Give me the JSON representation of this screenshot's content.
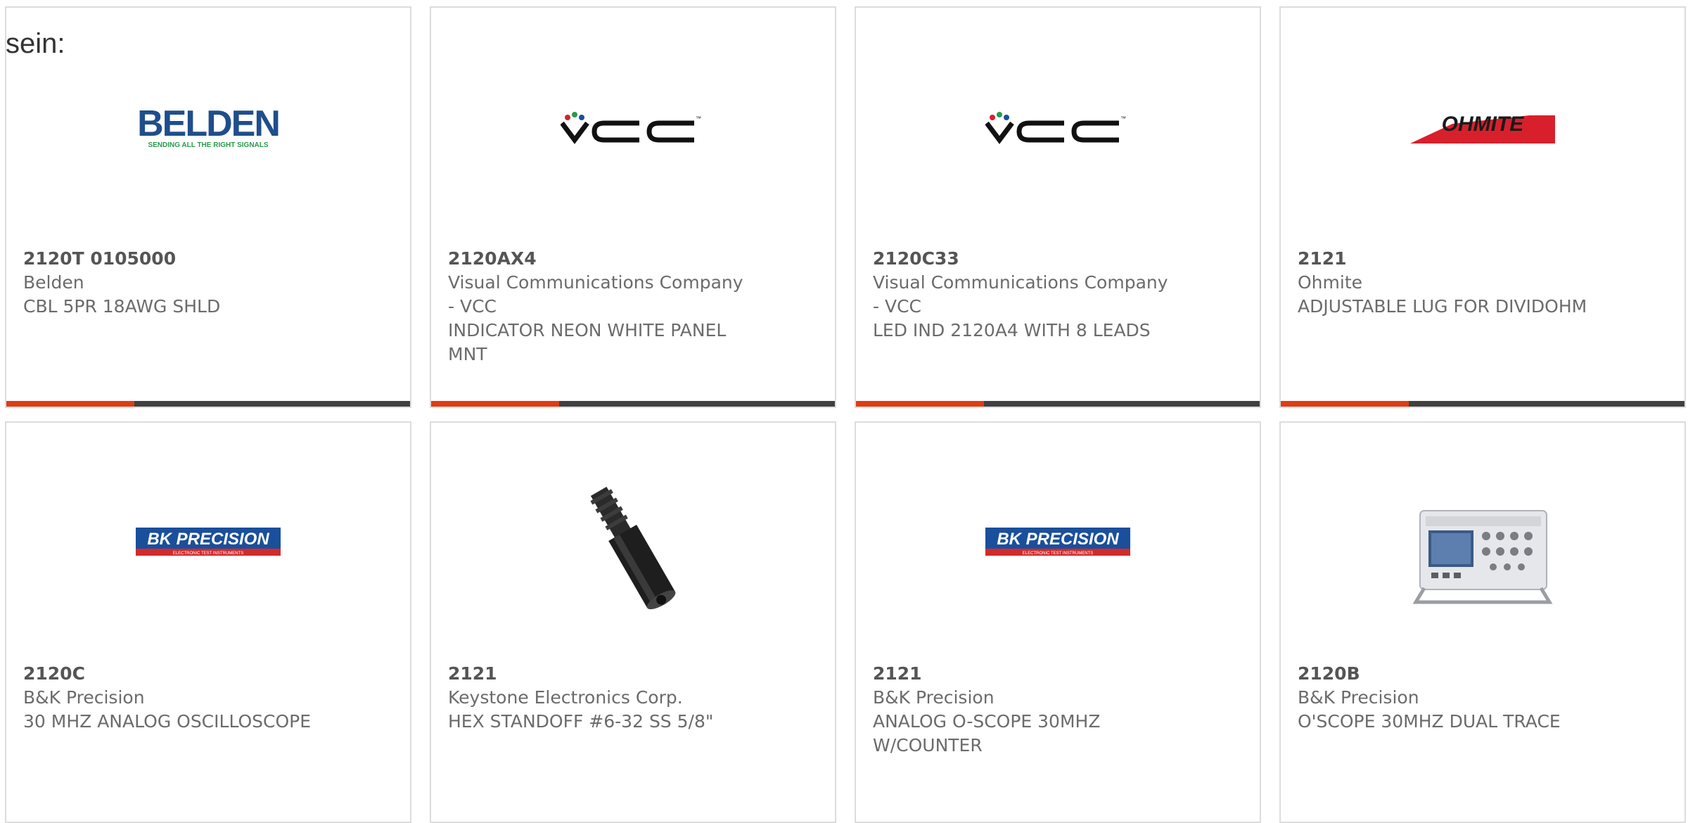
{
  "intro_text": "sein:",
  "products": [
    {
      "part": "2120T 0105000",
      "manufacturer": "Belden",
      "description": "CBL 5PR 18AWG SHLD",
      "logo": "belden-logo",
      "logo_text": "BELDEN",
      "logo_tagline": "SENDING ALL THE RIGHT SIGNALS",
      "has_bar": true
    },
    {
      "part": "2120AX4",
      "manufacturer": "Visual Communications Company - VCC",
      "description": "INDICATOR NEON WHITE PANEL MNT",
      "logo": "vcc-logo",
      "logo_text": "VCC",
      "has_bar": true
    },
    {
      "part": "2120C33",
      "manufacturer": "Visual Communications Company - VCC",
      "description": "LED IND 2120A4 WITH 8 LEADS",
      "logo": "vcc-logo",
      "logo_text": "VCC",
      "has_bar": true
    },
    {
      "part": "2121",
      "manufacturer": "Ohmite",
      "description": "ADJUSTABLE LUG FOR DIVIDOHM",
      "logo": "ohmite-logo",
      "logo_text": "OHMITE",
      "has_bar": true
    },
    {
      "part": "2120C",
      "manufacturer": "B&K Precision",
      "description": "30 MHZ ANALOG OSCILLOSCOPE",
      "logo": "bk-precision-logo",
      "logo_text": "BK PRECISION",
      "logo_tagline": "ELECTRONIC TEST INSTRUMENTS",
      "has_bar": false
    },
    {
      "part": "2121",
      "manufacturer": "Keystone Electronics Corp.",
      "description": "HEX STANDOFF #6-32 SS 5/8\"",
      "logo": "hex-standoff-image",
      "logo_text": "",
      "has_bar": false
    },
    {
      "part": "2121",
      "manufacturer": "B&K Precision",
      "description": "ANALOG O-SCOPE 30MHZ W/COUNTER",
      "logo": "bk-precision-logo",
      "logo_text": "BK PRECISION",
      "logo_tagline": "ELECTRONIC TEST INSTRUMENTS",
      "has_bar": false
    },
    {
      "part": "2120B",
      "manufacturer": "B&K Precision",
      "description": "O'SCOPE 30MHZ DUAL TRACE",
      "logo": "oscilloscope-image",
      "logo_text": "",
      "has_bar": false
    }
  ],
  "colors": {
    "accent": "#e03c14",
    "bar": "#404040",
    "belden_blue": "#1f4e8c",
    "belden_green": "#2a9a4a",
    "ohmite_red": "#d8202c",
    "bk_blue": "#1a4f9c",
    "bk_red": "#d42a2a"
  }
}
